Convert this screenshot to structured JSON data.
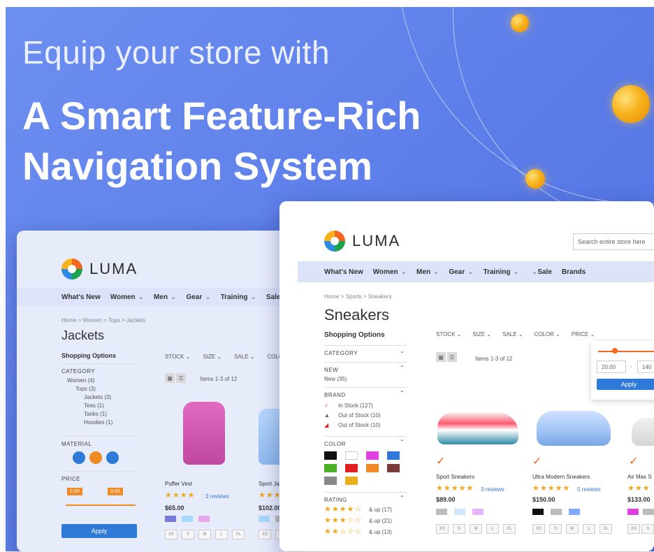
{
  "hero": {
    "line1": "Equip your store with",
    "line2": "A Smart Feature-Rich",
    "line3": "Navigation System",
    "accent": "#5b7ce8",
    "orb_color": "#f7b21c"
  },
  "brand": {
    "name": "LUMA"
  },
  "front": {
    "search_placeholder": "Search entire store here",
    "nav": [
      "What's New",
      "Women",
      "Men",
      "Gear",
      "Training",
      "Sale",
      "Brands"
    ],
    "breadcrumb": [
      "Home",
      ">",
      "Sports",
      ">",
      "Sneakers"
    ],
    "title": "Sneakers",
    "shopping_options": "Shopping Options",
    "filters": [
      "STOCK",
      "SIZE",
      "SALE",
      "COLOR",
      "PRICE"
    ],
    "items_text": "Items 1-3 of 12",
    "price_from": "20.00",
    "price_to": "140",
    "apply": "Apply",
    "facets": {
      "category": "CATEGORY",
      "new": "NEW",
      "new_value": "New (35)",
      "brand": "BRAND",
      "brand_items": [
        "In Stock (127)",
        "Out of Stock (10)",
        "Out of Stock (10)"
      ],
      "color": "COLOR",
      "colors": [
        "#111111",
        "#ffffff",
        "#e040e0",
        "#2f7ad8",
        "#4caf2a",
        "#e02020",
        "#f08a24",
        "#7a3a3a",
        "#888888",
        "#e8b020"
      ],
      "rating": "RATING",
      "ratings": [
        {
          "stars": "★★★★☆",
          "label": "& up (17)"
        },
        {
          "stars": "★★★☆☆",
          "label": "& up (21)"
        },
        {
          "stars": "★★☆☆☆",
          "label": "& up (13)"
        }
      ]
    },
    "products": [
      {
        "name": "Sport Sneakers",
        "stars": "★★★★★",
        "reviews": "3 reviews",
        "price": "$89.00",
        "swatches": [
          "#bdbdbd",
          "#cfe8ff",
          "#e6b3ff"
        ],
        "sizes": [
          "XS",
          "S",
          "M",
          "L",
          "XL"
        ]
      },
      {
        "name": "Ultra Modern Sneakers",
        "stars": "★★★★★",
        "reviews": "5 reviews",
        "price": "$150.00",
        "swatches": [
          "#111111",
          "#bdbdbd",
          "#7fa8ff"
        ],
        "sizes": [
          "XS",
          "S",
          "M",
          "L",
          "XL"
        ]
      },
      {
        "name": "Air Max S",
        "stars": "★★★",
        "reviews": "",
        "price": "$133.00",
        "swatches": [
          "#e040e0",
          "#bdbdbd"
        ],
        "sizes": [
          "XS",
          "S"
        ]
      }
    ]
  },
  "back": {
    "nav": [
      "What's New",
      "Women",
      "Men",
      "Gear",
      "Training",
      "Sale"
    ],
    "breadcrumb": [
      "Home",
      ">",
      "Women",
      ">",
      "Tops",
      ">",
      "Jackets"
    ],
    "title": "Jackets",
    "shopping_options": "Shopping Options",
    "filters": [
      "STOCK",
      "SIZE",
      "SALE",
      "COLO"
    ],
    "items_text": "Items 1-3 of 12",
    "category": "CATEGORY",
    "tree": [
      "Women (4)",
      "Tops (3)",
      "Jackets (3)",
      "Tees (1)",
      "Tanks (1)",
      "Hoodies (1)"
    ],
    "material": "MATERIAL",
    "price": "PRICE",
    "price_min_tag": "5.00",
    "price_max_tag": "9.00",
    "apply": "Apply",
    "products": [
      {
        "name": "Puffer Vest",
        "stars": "★★★★",
        "reviews": "3 reviews",
        "price": "$65.00",
        "swatches": [
          "#7a7ad8",
          "#a8d8ff",
          "#e6a8e6"
        ],
        "sizes": [
          "XS",
          "S",
          "M",
          "L",
          "XL"
        ]
      },
      {
        "name": "Sport Jacke",
        "stars": "★★★",
        "reviews": "",
        "price": "$102.00",
        "swatches": [
          "#a8d8ff",
          "#bdbdbd"
        ],
        "sizes": [
          "XS",
          "S"
        ]
      }
    ]
  }
}
